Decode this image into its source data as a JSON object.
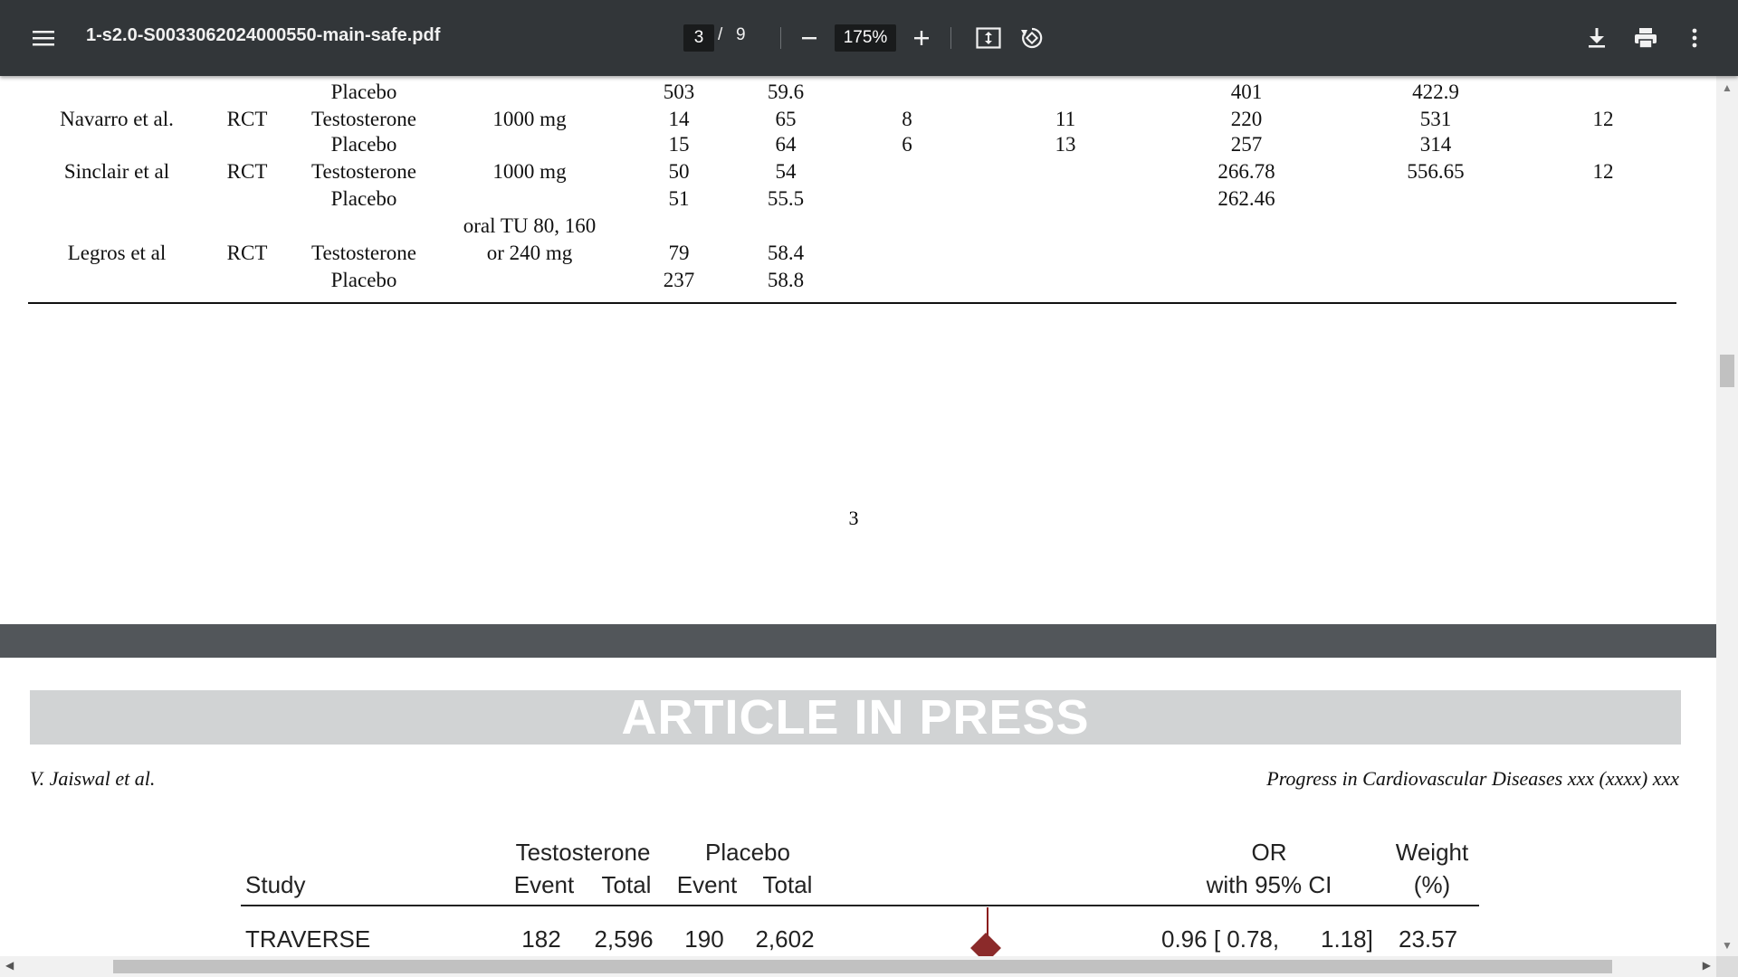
{
  "toolbar": {
    "file_name": "1-s2.0-S0033062024000550-main-safe.pdf",
    "current_page": "3",
    "page_separator": "/",
    "total_pages": "9",
    "zoom": "175%",
    "icons": [
      "menu-icon",
      "zoom-out-icon",
      "zoom-in-icon",
      "fit-page-icon",
      "rotate-icon",
      "download-icon",
      "print-icon",
      "more-options-icon"
    ]
  },
  "page3": {
    "rows": [
      [
        "",
        "",
        "Placebo",
        "",
        "503",
        "59.6",
        "",
        "",
        "401",
        "422.9",
        ""
      ],
      [
        "Navarro et al.",
        "RCT",
        "Testosterone",
        "1000 mg",
        "14",
        "65",
        "8",
        "11",
        "220",
        "531",
        "12"
      ],
      [
        "",
        "",
        "Placebo",
        "",
        "15",
        "64",
        "6",
        "13",
        "257",
        "314",
        ""
      ],
      [
        "Sinclair et al",
        "RCT",
        "Testosterone",
        "1000 mg",
        "50",
        "54",
        "",
        "",
        "266.78",
        "556.65",
        "12"
      ],
      [
        "",
        "",
        "Placebo",
        "",
        "51",
        "55.5",
        "",
        "",
        "262.46",
        "",
        ""
      ],
      [
        "",
        "",
        "",
        "oral TU 80, 160",
        "",
        "",
        "",
        "",
        "",
        "",
        ""
      ],
      [
        "Legros et al",
        "RCT",
        "Testosterone",
        "or 240 mg",
        "79",
        "58.4",
        "",
        "",
        "",
        "",
        ""
      ],
      [
        "",
        "",
        "Placebo",
        "",
        "237",
        "58.8",
        "",
        "",
        "",
        "",
        ""
      ]
    ],
    "page_number": "3"
  },
  "page4": {
    "banner": "ARTICLE IN PRESS",
    "running_author": "V. Jaiswal et al.",
    "running_journal": "Progress in Cardiovascular Diseases xxx (xxxx) xxx",
    "forest": {
      "group_headers": [
        "Testosterone",
        "Placebo"
      ],
      "study_header": "Study",
      "event_header": "Event",
      "total_header": "Total",
      "or_header_1": "OR",
      "or_header_2": "with 95% CI",
      "weight_header_1": "Weight",
      "weight_header_2": "(%)",
      "rows": [
        {
          "study": "TRAVERSE",
          "t_event": "182",
          "t_total": "2,596",
          "p_event": "190",
          "p_total": "2,602",
          "or_text": "0.96 [ 0.78,",
          "ci_high": "1.18]",
          "weight": "23.57"
        }
      ]
    }
  },
  "colors": {
    "toolbar": "#323639",
    "diamond": "#8b2a2a",
    "banner": "#d1d3d4"
  }
}
